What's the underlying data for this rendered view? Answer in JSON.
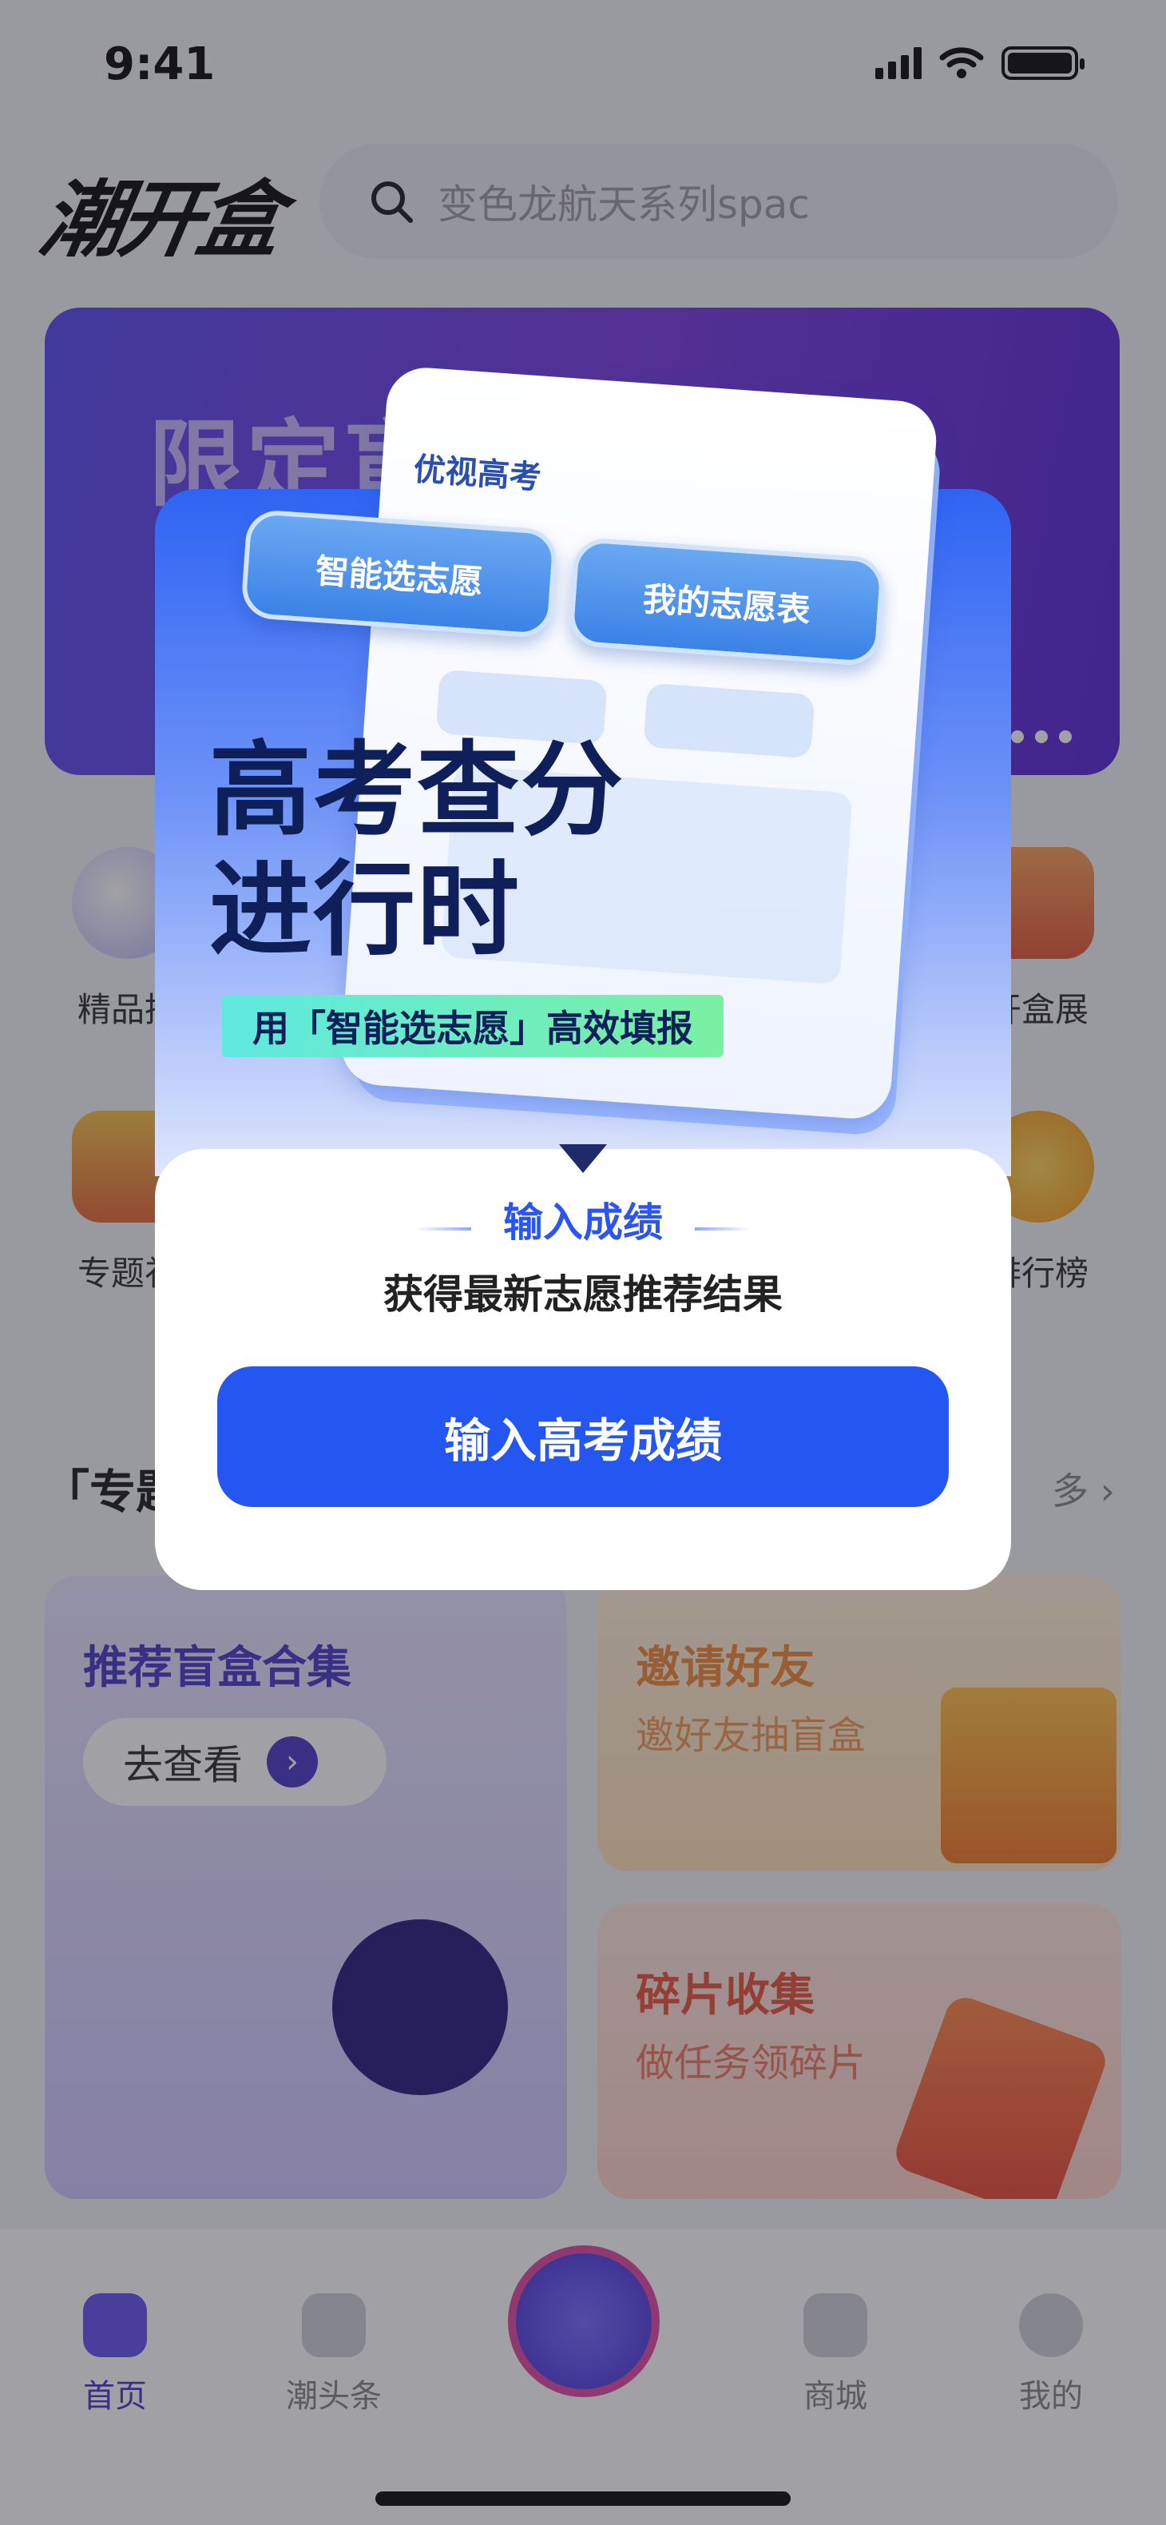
{
  "status_bar": {
    "time": "9:41"
  },
  "header": {
    "logo": "潮开盒",
    "search_placeholder": "变色龙航天系列spac"
  },
  "banner": {
    "title": "限定盲"
  },
  "categories": [
    {
      "label": "精品推"
    },
    {
      "label": "开盒展"
    },
    {
      "label": "专题礼"
    },
    {
      "label": "排行榜"
    }
  ],
  "topic_section": {
    "title": "「专题",
    "more_label": "多"
  },
  "cards": {
    "recommend": {
      "title": "推荐盲盒合集",
      "button": "去查看"
    },
    "invite": {
      "title": "邀请好友",
      "subtitle": "邀好友抽盲盒"
    },
    "fragments": {
      "title": "碎片收集",
      "subtitle": "做任务领碎片"
    }
  },
  "tabbar": {
    "home": "首页",
    "headlines": "潮头条",
    "mall": "商城",
    "mine": "我的"
  },
  "dialog": {
    "paper_title": "优视高考",
    "tile_left": "智能选志愿",
    "tile_right": "我的志愿表",
    "headline_line1": "高考查分",
    "headline_line2": "进行时",
    "slogan": "用「智能选志愿」高效填报",
    "subtitle": "输入成绩",
    "description": "获得最新志愿推荐结果",
    "button": "输入高考成绩"
  },
  "colors": {
    "accent": "#2456f2",
    "headline": "#0f1f5a",
    "invite": "#f08a3c",
    "fragment": "#e8573f"
  }
}
